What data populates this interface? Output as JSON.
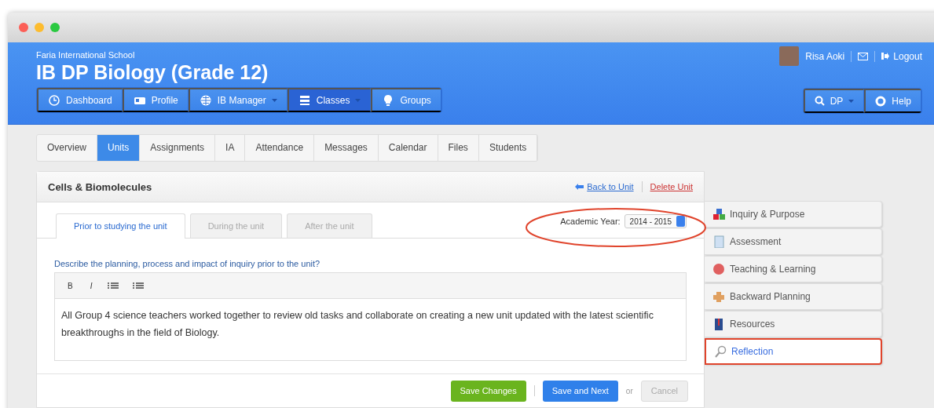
{
  "header": {
    "school": "Faria International School",
    "title": "IB DP Biology (Grade 12)",
    "user": {
      "name": "Risa Aoki",
      "logout": "Logout"
    },
    "nav": [
      {
        "label": "Dashboard",
        "dropdown": false,
        "selected": false
      },
      {
        "label": "Profile",
        "dropdown": false,
        "selected": false
      },
      {
        "label": "IB Manager",
        "dropdown": true,
        "selected": false
      },
      {
        "label": "Classes",
        "dropdown": true,
        "selected": true
      },
      {
        "label": "Groups",
        "dropdown": false,
        "selected": false
      }
    ],
    "tools": [
      {
        "label": "DP",
        "dropdown": true
      },
      {
        "label": "Help",
        "dropdown": false
      }
    ]
  },
  "class_tabs": [
    {
      "label": "Overview",
      "selected": false
    },
    {
      "label": "Units",
      "selected": true
    },
    {
      "label": "Assignments",
      "selected": false
    },
    {
      "label": "IA",
      "selected": false
    },
    {
      "label": "Attendance",
      "selected": false
    },
    {
      "label": "Messages",
      "selected": false
    },
    {
      "label": "Calendar",
      "selected": false
    },
    {
      "label": "Files",
      "selected": false
    },
    {
      "label": "Students",
      "selected": false
    }
  ],
  "unit": {
    "title": "Cells & Biomolecules",
    "back_link": "Back to Unit",
    "delete_link": "Delete Unit",
    "phase_tabs": [
      {
        "label": "Prior to studying the unit",
        "selected": true
      },
      {
        "label": "During the unit",
        "selected": false
      },
      {
        "label": "After the unit",
        "selected": false
      }
    ],
    "academic_year": {
      "label": "Academic Year:",
      "value": "2014 - 2015"
    },
    "question": "Describe the planning, process and impact of inquiry prior to the unit?",
    "toolbar": [
      "B",
      "I"
    ],
    "text": "All Group 4 science teachers worked together to review old tasks and collaborate on creating a new unit updated with the latest scientific breakthroughs in the field of Biology.",
    "actions": {
      "save": "Save Changes",
      "save_next": "Save and Next",
      "or": "or",
      "cancel": {
        "label": "Cancel",
        "disabled": true
      }
    }
  },
  "sidebar": [
    {
      "label": "Inquiry & Purpose",
      "selected": false
    },
    {
      "label": "Assessment",
      "selected": false
    },
    {
      "label": "Teaching & Learning",
      "selected": false
    },
    {
      "label": "Backward Planning",
      "selected": false
    },
    {
      "label": "Resources",
      "selected": false
    },
    {
      "label": "Reflection",
      "selected": true
    }
  ]
}
